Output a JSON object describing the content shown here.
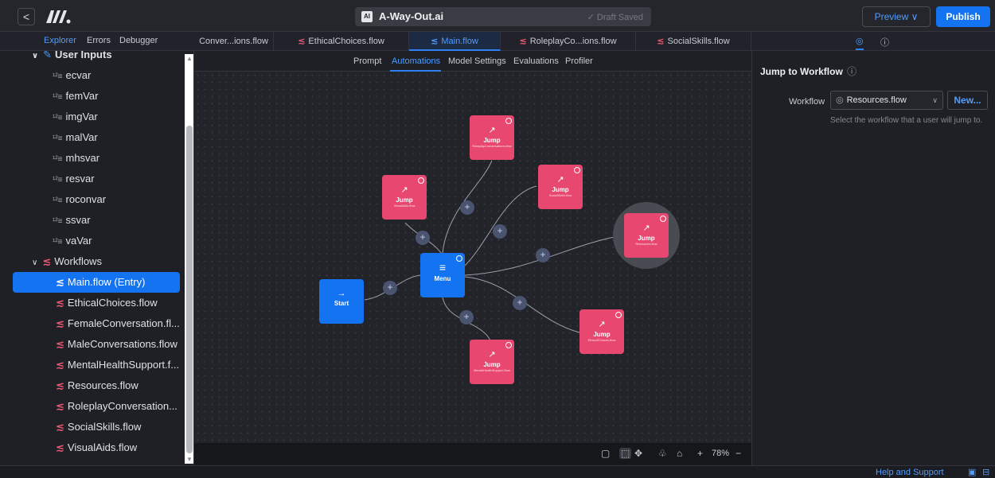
{
  "topbar": {
    "back_glyph": "<",
    "logo_name": "m-logo",
    "ai_badge": "AI",
    "title": "A-Way-Out.ai",
    "draft_status": "✓ Draft Saved",
    "preview_label": "Preview ∨",
    "publish_label": "Publish"
  },
  "left_tabs": [
    "Explorer",
    "Errors",
    "Debugger"
  ],
  "file_tabs": [
    {
      "label": "Conver...ions.flow",
      "active": false,
      "glyph": ""
    },
    {
      "label": "EthicalChoices.flow",
      "active": false,
      "glyph": "≲"
    },
    {
      "label": "Main.flow",
      "active": true,
      "glyph": "≲"
    },
    {
      "label": "RoleplayCo...ions.flow",
      "active": false,
      "glyph": "≲"
    },
    {
      "label": "SocialSkills.flow",
      "active": false,
      "glyph": "≲"
    }
  ],
  "right_tab_icons": [
    "◎",
    "ⓘ"
  ],
  "sidebar": {
    "inputs_group": "User Inputs",
    "inputs_glyph": "∨",
    "inputs_icon": "✎",
    "variables": [
      "ecvar",
      "femVar",
      "imgVar",
      "malVar",
      "mhsvar",
      "resvar",
      "roconvar",
      "ssvar",
      "vaVar"
    ],
    "var_glyph": "¹²≡",
    "workflows_group": "Workflows",
    "workflows_glyph": "∨",
    "workflows": [
      "Main.flow (Entry)",
      "EthicalChoices.flow",
      "FemaleConversation.fl...",
      "MaleConversations.flow",
      "MentalHealthSupport.f...",
      "Resources.flow",
      "RoleplayConversation...",
      "SocialSkills.flow",
      "VisualAids.flow"
    ],
    "wf_glyph": "≲",
    "selected_index": 0,
    "scroll_up": "▲",
    "scroll_down": "▼"
  },
  "canvas": {
    "subtabs": [
      "Prompt",
      "Automations",
      "Model Settings",
      "Evaluations",
      "Profiler"
    ],
    "active_subtab": 1,
    "start": {
      "icon": "→",
      "title": "Start"
    },
    "menu": {
      "icon": "≡",
      "title": "Menu",
      "min": "⊖"
    },
    "jump_nodes": [
      {
        "title": "Jump",
        "sub": "RoleplayConversations.flow",
        "icon": "↗"
      },
      {
        "title": "Jump",
        "sub": "VisualAids.flow",
        "icon": "↗"
      },
      {
        "title": "Jump",
        "sub": "SocialSkills.flow",
        "icon": "↗"
      },
      {
        "title": "Jump",
        "sub": "Resources.flow",
        "icon": "↗"
      },
      {
        "title": "Jump",
        "sub": "EthicalChoices.flow",
        "icon": "↗"
      },
      {
        "title": "Jump",
        "sub": "MentalHealthSupport.flow",
        "icon": "↗"
      }
    ],
    "plus_glyph": "+",
    "min_glyph": "⊖",
    "toolbar": {
      "sticky": "▢",
      "select": "⬚",
      "move": "✥",
      "layout": "♧",
      "home": "⌂",
      "zoom_in": "+",
      "zoom": "78%",
      "zoom_out": "−"
    }
  },
  "right_panel": {
    "heading": "Jump to Workflow",
    "heading_info": "ⓘ",
    "workflow_label": "Workflow",
    "workflow_icon": "◎",
    "selected_workflow": "Resources.flow",
    "chevron": "∨",
    "new_label": "New...",
    "help_text": "Select the workflow that a user will jump to."
  },
  "statusbar": {
    "help": "Help and Support",
    "icons": [
      "▣",
      "⊟"
    ]
  },
  "colors": {
    "accent": "#1473f0",
    "jump_node": "#e8476f",
    "background": "#1b1c21"
  }
}
